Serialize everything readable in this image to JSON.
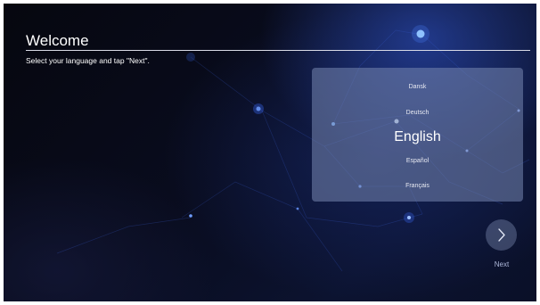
{
  "welcome": {
    "title": "Welcome",
    "subtitle": "Select your language and tap \"Next\"."
  },
  "language_list": {
    "items": [
      {
        "label": "Dansk",
        "selected": false
      },
      {
        "label": "Deutsch",
        "selected": false
      },
      {
        "label": "English",
        "selected": true
      },
      {
        "label": "Español",
        "selected": false
      },
      {
        "label": "Français",
        "selected": false
      }
    ]
  },
  "next_button": {
    "label": "Next",
    "icon": "chevron-right-icon"
  }
}
